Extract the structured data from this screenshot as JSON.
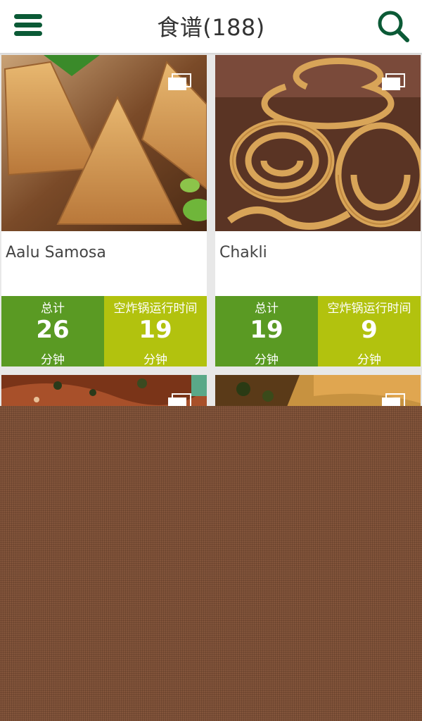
{
  "header": {
    "title": "食谱(188)",
    "menu_icon": "hamburger-menu-icon",
    "search_icon": "search-icon",
    "accent_color": "#0b5a36"
  },
  "stat_labels": {
    "total": "总计",
    "airfryer": "空炸锅运行时间",
    "unit": "分钟"
  },
  "recipes": [
    {
      "name": "Aalu Samosa",
      "total_minutes": "26",
      "airfryer_minutes": "19"
    },
    {
      "name": "Chakli",
      "total_minutes": "19",
      "airfryer_minutes": "9"
    },
    {
      "name": "",
      "total_minutes": "",
      "airfryer_minutes": ""
    },
    {
      "name": "",
      "total_minutes": "",
      "airfryer_minutes": ""
    }
  ],
  "colors": {
    "total_bg": "#5a9a23",
    "airfryer_bg": "#b2c20e",
    "overlay": "#8a5a3f"
  }
}
